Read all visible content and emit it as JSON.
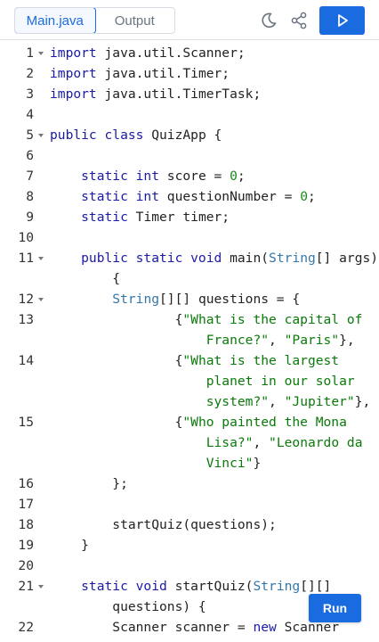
{
  "tabs": [
    {
      "label": "Main.java",
      "active": true
    },
    {
      "label": "Output",
      "active": false
    }
  ],
  "icons": {
    "theme": "moon-icon",
    "share": "share-icon",
    "run": "play-icon"
  },
  "run_button": {
    "label": "Run"
  },
  "colors": {
    "accent": "#1a6be0",
    "keyword": "#1a1aa6",
    "type": "#3377aa",
    "string": "#0a7a0a",
    "number": "#1a8a1a"
  },
  "code": [
    {
      "num": "1",
      "fold": true,
      "rows": [
        [
          [
            "kw",
            "import"
          ],
          [
            "pl",
            " java.util.Scanner;"
          ]
        ]
      ]
    },
    {
      "num": "2",
      "fold": false,
      "rows": [
        [
          [
            "kw",
            "import"
          ],
          [
            "pl",
            " java.util.Timer;"
          ]
        ]
      ]
    },
    {
      "num": "3",
      "fold": false,
      "rows": [
        [
          [
            "kw",
            "import"
          ],
          [
            "pl",
            " java.util.TimerTask;"
          ]
        ]
      ]
    },
    {
      "num": "4",
      "fold": false,
      "rows": [
        []
      ]
    },
    {
      "num": "5",
      "fold": true,
      "rows": [
        [
          [
            "kw",
            "public class"
          ],
          [
            "pl",
            " QuizApp {"
          ]
        ]
      ]
    },
    {
      "num": "6",
      "fold": false,
      "rows": [
        []
      ]
    },
    {
      "num": "7",
      "fold": false,
      "rows": [
        [
          [
            "pl",
            "    "
          ],
          [
            "kw",
            "static int"
          ],
          [
            "pl",
            " score = "
          ],
          [
            "num",
            "0"
          ],
          [
            "pl",
            ";"
          ]
        ]
      ]
    },
    {
      "num": "8",
      "fold": false,
      "rows": [
        [
          [
            "pl",
            "    "
          ],
          [
            "kw",
            "static int"
          ],
          [
            "pl",
            " questionNumber = "
          ],
          [
            "num",
            "0"
          ],
          [
            "pl",
            ";"
          ]
        ]
      ]
    },
    {
      "num": "9",
      "fold": false,
      "rows": [
        [
          [
            "pl",
            "    "
          ],
          [
            "kw",
            "static"
          ],
          [
            "pl",
            " Timer timer;"
          ]
        ]
      ]
    },
    {
      "num": "10",
      "fold": false,
      "rows": [
        []
      ]
    },
    {
      "num": "11",
      "fold": true,
      "rows": [
        [
          [
            "pl",
            "    "
          ],
          [
            "kw",
            "public static void"
          ],
          [
            "pl",
            " main("
          ],
          [
            "typ",
            "String"
          ],
          [
            "pl",
            "[] args)"
          ]
        ],
        [
          [
            "pl",
            "        {"
          ]
        ]
      ]
    },
    {
      "num": "12",
      "fold": true,
      "rows": [
        [
          [
            "pl",
            "        "
          ],
          [
            "typ",
            "String"
          ],
          [
            "pl",
            "[][] questions = {"
          ]
        ]
      ]
    },
    {
      "num": "13",
      "fold": false,
      "rows": [
        [
          [
            "pl",
            "                {"
          ],
          [
            "str",
            "\"What is the capital of"
          ]
        ],
        [
          [
            "str",
            "                    France?\""
          ],
          [
            "pl",
            ", "
          ],
          [
            "str",
            "\"Paris\""
          ],
          [
            "pl",
            "},"
          ]
        ]
      ]
    },
    {
      "num": "14",
      "fold": false,
      "rows": [
        [
          [
            "pl",
            "                {"
          ],
          [
            "str",
            "\"What is the largest"
          ]
        ],
        [
          [
            "str",
            "                    planet in our solar"
          ]
        ],
        [
          [
            "str",
            "                    system?\""
          ],
          [
            "pl",
            ", "
          ],
          [
            "str",
            "\"Jupiter\""
          ],
          [
            "pl",
            "},"
          ]
        ]
      ]
    },
    {
      "num": "15",
      "fold": false,
      "rows": [
        [
          [
            "pl",
            "                {"
          ],
          [
            "str",
            "\"Who painted the Mona"
          ]
        ],
        [
          [
            "str",
            "                    Lisa?\""
          ],
          [
            "pl",
            ", "
          ],
          [
            "str",
            "\"Leonardo da"
          ]
        ],
        [
          [
            "str",
            "                    Vinci\""
          ],
          [
            "pl",
            "}"
          ]
        ]
      ]
    },
    {
      "num": "16",
      "fold": false,
      "rows": [
        [
          [
            "pl",
            "        };"
          ]
        ]
      ]
    },
    {
      "num": "17",
      "fold": false,
      "rows": [
        []
      ]
    },
    {
      "num": "18",
      "fold": false,
      "rows": [
        [
          [
            "pl",
            "        startQuiz(questions);"
          ]
        ]
      ]
    },
    {
      "num": "19",
      "fold": false,
      "rows": [
        [
          [
            "pl",
            "    }"
          ]
        ]
      ]
    },
    {
      "num": "20",
      "fold": false,
      "rows": [
        []
      ]
    },
    {
      "num": "21",
      "fold": true,
      "rows": [
        [
          [
            "pl",
            "    "
          ],
          [
            "kw",
            "static void"
          ],
          [
            "pl",
            " startQuiz("
          ],
          [
            "typ",
            "String"
          ],
          [
            "pl",
            "[][]"
          ]
        ],
        [
          [
            "pl",
            "        questions) {"
          ]
        ]
      ]
    },
    {
      "num": "22",
      "fold": false,
      "rows": [
        [
          [
            "pl",
            "        Scanner scanner = "
          ],
          [
            "kw",
            "new"
          ],
          [
            "pl",
            " Scanner"
          ]
        ]
      ]
    }
  ]
}
